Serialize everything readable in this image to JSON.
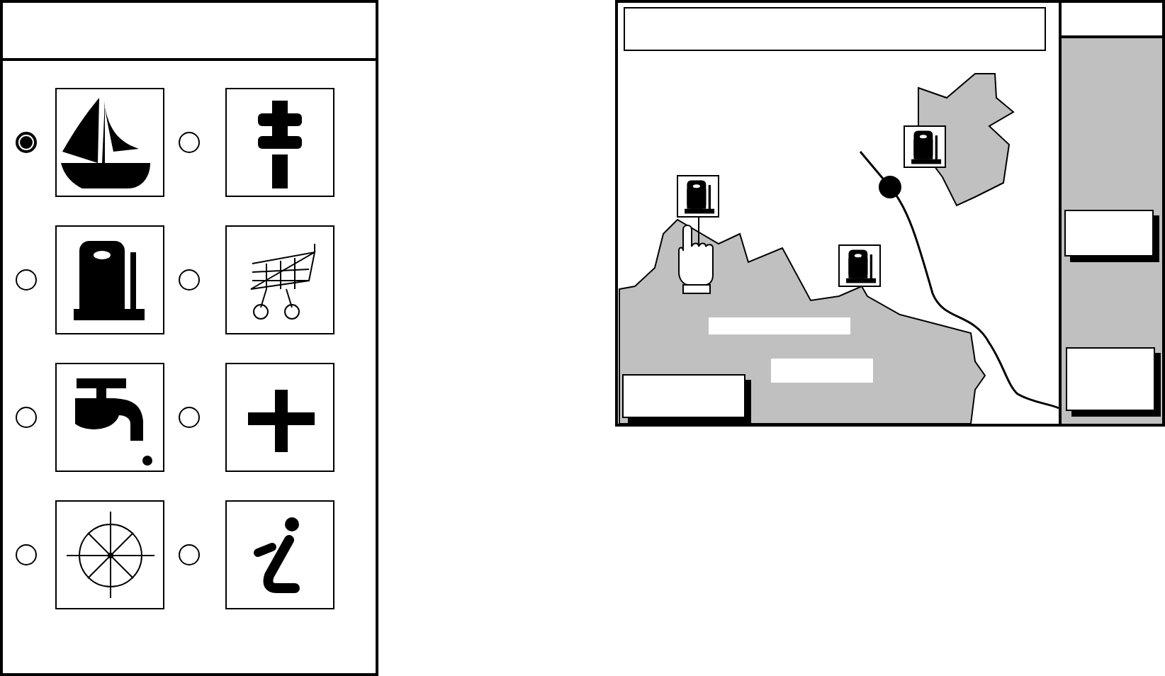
{
  "symbols": [
    {
      "kind": "sailboat",
      "selected": true
    },
    {
      "kind": "post",
      "selected": false
    },
    {
      "kind": "fuel",
      "selected": false
    },
    {
      "kind": "cart",
      "selected": false
    },
    {
      "kind": "tap",
      "selected": false
    },
    {
      "kind": "plus",
      "selected": false
    },
    {
      "kind": "wheel",
      "selected": false
    },
    {
      "kind": "info",
      "selected": false
    }
  ]
}
